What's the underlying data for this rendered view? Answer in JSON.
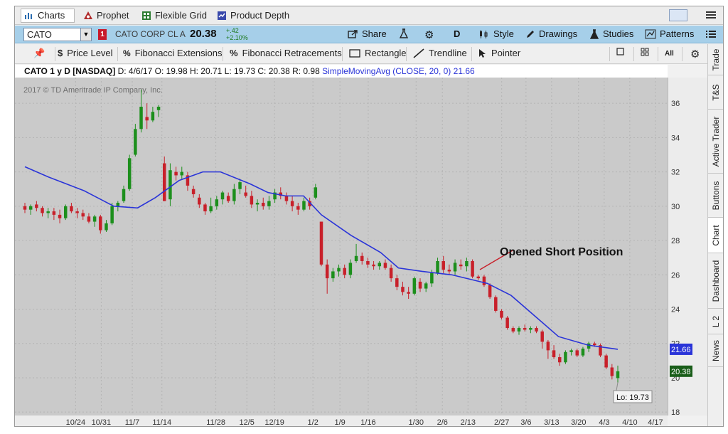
{
  "tabs": {
    "charts": "Charts",
    "prophet": "Prophet",
    "flexible_grid": "Flexible Grid",
    "product_depth": "Product Depth"
  },
  "symbol_bar": {
    "symbol": "CATO",
    "badge": "1",
    "company": "CATO CORP CL A",
    "last_price": "20.38",
    "change": "+.42",
    "change_pct": "+2.10%",
    "share": "Share",
    "aggregation": "D",
    "style": "Style",
    "drawings": "Drawings",
    "studies": "Studies",
    "patterns": "Patterns"
  },
  "drawing_tools": {
    "price_level": "Price Level",
    "fib_ext": "Fibonacci Extensions",
    "fib_ret": "Fibonacci Retracements",
    "rectangle": "Rectangle",
    "trendline": "Trendline",
    "pointer": "Pointer",
    "all": "All"
  },
  "info": {
    "symbol_period": "CATO 1 y D [NASDAQ]",
    "ohlc": "D: 4/6/17  O: 19.98  H: 20.71  L: 19.73  C: 20.38  R: 0.98",
    "study": "SimpleMovingAvg (CLOSE, 20, 0)",
    "study_value": "21.66"
  },
  "side_tabs": [
    "Trade",
    "T&S",
    "Active Trader",
    "Buttons",
    "Chart",
    "Dashboard",
    "L 2",
    "News"
  ],
  "chart_data": {
    "type": "candlestick",
    "copyright": "2017 © TD Ameritrade IP Company, Inc.",
    "annotation": "Opened Short Position",
    "low_label": "Lo: 19.73",
    "sma_label": "21.66",
    "last_label": "20.38",
    "y_ticks": [
      "36",
      "34",
      "32",
      "30",
      "28",
      "26",
      "24",
      "22",
      "20",
      "18"
    ],
    "x_ticks": [
      "10/24",
      "10/31",
      "11/7",
      "11/14",
      "11/28",
      "12/5",
      "12/19",
      "1/2",
      "1/9",
      "1/16",
      "1/30",
      "2/6",
      "2/13",
      "2/27",
      "3/6",
      "3/13",
      "3/20",
      "4/3",
      "4/10",
      "4/17"
    ],
    "ylim": [
      17.8,
      37.5
    ],
    "colors": {
      "up": "#1c8f1c",
      "down": "#c8202a",
      "sma": "#2a34d8",
      "bg": "#cacaca"
    },
    "candles": [
      [
        30.0,
        30.2,
        29.6,
        29.8
      ],
      [
        29.8,
        30.1,
        29.5,
        30.0
      ],
      [
        30.1,
        30.3,
        29.7,
        29.9
      ],
      [
        29.9,
        30.0,
        29.4,
        29.6
      ],
      [
        29.6,
        29.9,
        29.3,
        29.7
      ],
      [
        29.7,
        29.9,
        29.2,
        29.5
      ],
      [
        29.5,
        29.8,
        29.0,
        29.3
      ],
      [
        29.3,
        30.1,
        29.2,
        30.0
      ],
      [
        30.0,
        30.2,
        29.6,
        29.7
      ],
      [
        29.7,
        29.9,
        29.3,
        29.6
      ],
      [
        29.6,
        29.8,
        29.2,
        29.4
      ],
      [
        29.4,
        29.6,
        29.0,
        29.1
      ],
      [
        29.1,
        29.5,
        28.8,
        29.4
      ],
      [
        29.4,
        29.5,
        28.4,
        28.6
      ],
      [
        28.6,
        29.2,
        28.5,
        29.0
      ],
      [
        29.0,
        30.2,
        28.9,
        30.0
      ],
      [
        30.0,
        30.3,
        29.7,
        30.2
      ],
      [
        30.3,
        31.2,
        30.2,
        31.0
      ],
      [
        31.0,
        33.0,
        30.9,
        32.8
      ],
      [
        33.0,
        34.8,
        32.9,
        34.5
      ],
      [
        34.5,
        36.8,
        34.3,
        35.8
      ],
      [
        35.2,
        36.0,
        34.5,
        35.0
      ],
      [
        35.0,
        35.8,
        34.9,
        35.5
      ],
      [
        35.6,
        35.9,
        35.2,
        35.8
      ],
      [
        32.5,
        32.9,
        30.3,
        30.3
      ],
      [
        30.4,
        32.5,
        30.0,
        32.1
      ],
      [
        32.0,
        32.3,
        31.5,
        31.8
      ],
      [
        31.8,
        32.3,
        31.6,
        32.0
      ],
      [
        31.8,
        32.0,
        30.9,
        31.2
      ],
      [
        31.0,
        31.2,
        30.5,
        30.7
      ],
      [
        30.5,
        30.7,
        29.9,
        30.1
      ],
      [
        30.1,
        30.2,
        29.5,
        29.7
      ],
      [
        29.7,
        30.5,
        29.6,
        30.0
      ],
      [
        30.0,
        30.6,
        29.8,
        30.4
      ],
      [
        30.4,
        30.9,
        30.1,
        30.8
      ],
      [
        30.6,
        30.8,
        30.2,
        30.3
      ],
      [
        30.3,
        31.3,
        30.1,
        31.0
      ],
      [
        31.0,
        31.6,
        30.7,
        31.4
      ],
      [
        30.8,
        31.2,
        30.5,
        30.6
      ],
      [
        30.6,
        30.9,
        29.9,
        30.1
      ],
      [
        30.1,
        30.4,
        29.7,
        30.2
      ],
      [
        30.2,
        30.5,
        29.8,
        30.0
      ],
      [
        30.0,
        30.6,
        29.8,
        30.3
      ],
      [
        30.4,
        31.0,
        30.2,
        30.8
      ],
      [
        30.8,
        31.1,
        30.4,
        30.6
      ],
      [
        30.6,
        30.8,
        30.1,
        30.3
      ],
      [
        30.3,
        30.6,
        29.7,
        30.0
      ],
      [
        30.0,
        30.2,
        29.5,
        29.8
      ],
      [
        29.8,
        30.5,
        29.7,
        30.3
      ],
      [
        30.3,
        30.5,
        29.8,
        30.0
      ],
      [
        30.5,
        31.3,
        30.4,
        31.1
      ],
      [
        29.1,
        29.1,
        26.5,
        26.6
      ],
      [
        26.6,
        26.9,
        24.9,
        25.8
      ],
      [
        25.8,
        26.4,
        25.6,
        26.2
      ],
      [
        26.2,
        26.6,
        25.9,
        26.4
      ],
      [
        26.4,
        26.6,
        25.8,
        26.0
      ],
      [
        26.0,
        26.9,
        25.8,
        26.7
      ],
      [
        26.8,
        27.8,
        26.7,
        27.1
      ],
      [
        27.1,
        27.3,
        26.6,
        26.8
      ],
      [
        26.8,
        27.0,
        26.4,
        26.6
      ],
      [
        26.6,
        26.8,
        26.3,
        26.5
      ],
      [
        26.5,
        26.8,
        26.3,
        26.7
      ],
      [
        26.7,
        26.9,
        26.3,
        26.4
      ],
      [
        26.4,
        26.6,
        25.6,
        25.8
      ],
      [
        25.8,
        26.0,
        25.1,
        25.3
      ],
      [
        25.3,
        25.6,
        24.8,
        25.0
      ],
      [
        25.0,
        25.3,
        24.6,
        24.9
      ],
      [
        24.9,
        25.9,
        24.8,
        25.8
      ],
      [
        25.6,
        25.8,
        25.0,
        25.2
      ],
      [
        25.2,
        25.6,
        25.0,
        25.5
      ],
      [
        25.5,
        26.3,
        25.3,
        26.1
      ],
      [
        26.1,
        27.0,
        26.0,
        26.8
      ],
      [
        26.8,
        27.1,
        26.1,
        26.3
      ],
      [
        26.3,
        26.6,
        26.0,
        26.2
      ],
      [
        26.2,
        26.9,
        26.0,
        26.7
      ],
      [
        26.6,
        26.9,
        26.3,
        26.5
      ],
      [
        26.5,
        27.0,
        26.2,
        26.8
      ],
      [
        26.8,
        26.9,
        25.8,
        25.9
      ],
      [
        25.9,
        26.0,
        25.7,
        25.8
      ],
      [
        25.9,
        26.0,
        25.3,
        25.4
      ],
      [
        25.4,
        25.5,
        24.6,
        24.7
      ],
      [
        24.7,
        24.8,
        23.8,
        23.9
      ],
      [
        23.9,
        24.0,
        23.4,
        23.5
      ],
      [
        23.5,
        23.6,
        22.8,
        22.9
      ],
      [
        22.9,
        23.0,
        22.6,
        22.7
      ],
      [
        22.7,
        23.0,
        22.5,
        22.9
      ],
      [
        22.9,
        23.1,
        22.7,
        22.8
      ],
      [
        22.8,
        23.0,
        22.6,
        22.9
      ],
      [
        22.9,
        23.0,
        22.6,
        22.7
      ],
      [
        22.7,
        22.8,
        21.7,
        22.1
      ],
      [
        22.1,
        22.2,
        21.1,
        21.6
      ],
      [
        21.6,
        21.9,
        21.1,
        21.2
      ],
      [
        21.2,
        21.4,
        20.7,
        20.9
      ],
      [
        20.9,
        21.6,
        20.8,
        21.5
      ],
      [
        21.5,
        21.7,
        21.3,
        21.6
      ],
      [
        21.6,
        21.7,
        21.2,
        21.3
      ],
      [
        21.3,
        21.8,
        21.2,
        21.7
      ],
      [
        21.7,
        22.1,
        21.5,
        22.0
      ],
      [
        22.0,
        22.1,
        21.8,
        21.9
      ],
      [
        21.9,
        22.0,
        21.2,
        21.3
      ],
      [
        21.3,
        21.4,
        20.5,
        20.6
      ],
      [
        20.6,
        20.8,
        19.9,
        20.1
      ],
      [
        19.98,
        20.71,
        19.73,
        20.38
      ]
    ],
    "sma": [
      [
        0,
        32.3
      ],
      [
        0.04,
        31.7
      ],
      [
        0.1,
        30.9
      ],
      [
        0.15,
        30.0
      ],
      [
        0.19,
        29.9
      ],
      [
        0.22,
        30.5
      ],
      [
        0.26,
        31.5
      ],
      [
        0.3,
        32.0
      ],
      [
        0.33,
        32.0
      ],
      [
        0.38,
        31.3
      ],
      [
        0.41,
        30.8
      ],
      [
        0.44,
        30.6
      ],
      [
        0.47,
        30.6
      ],
      [
        0.5,
        29.5
      ],
      [
        0.55,
        28.3
      ],
      [
        0.6,
        27.3
      ],
      [
        0.63,
        26.4
      ],
      [
        0.67,
        26.2
      ],
      [
        0.72,
        26.0
      ],
      [
        0.78,
        25.5
      ],
      [
        0.82,
        24.8
      ],
      [
        0.86,
        23.6
      ],
      [
        0.9,
        22.4
      ],
      [
        0.95,
        21.9
      ],
      [
        1.0,
        21.66
      ]
    ]
  }
}
